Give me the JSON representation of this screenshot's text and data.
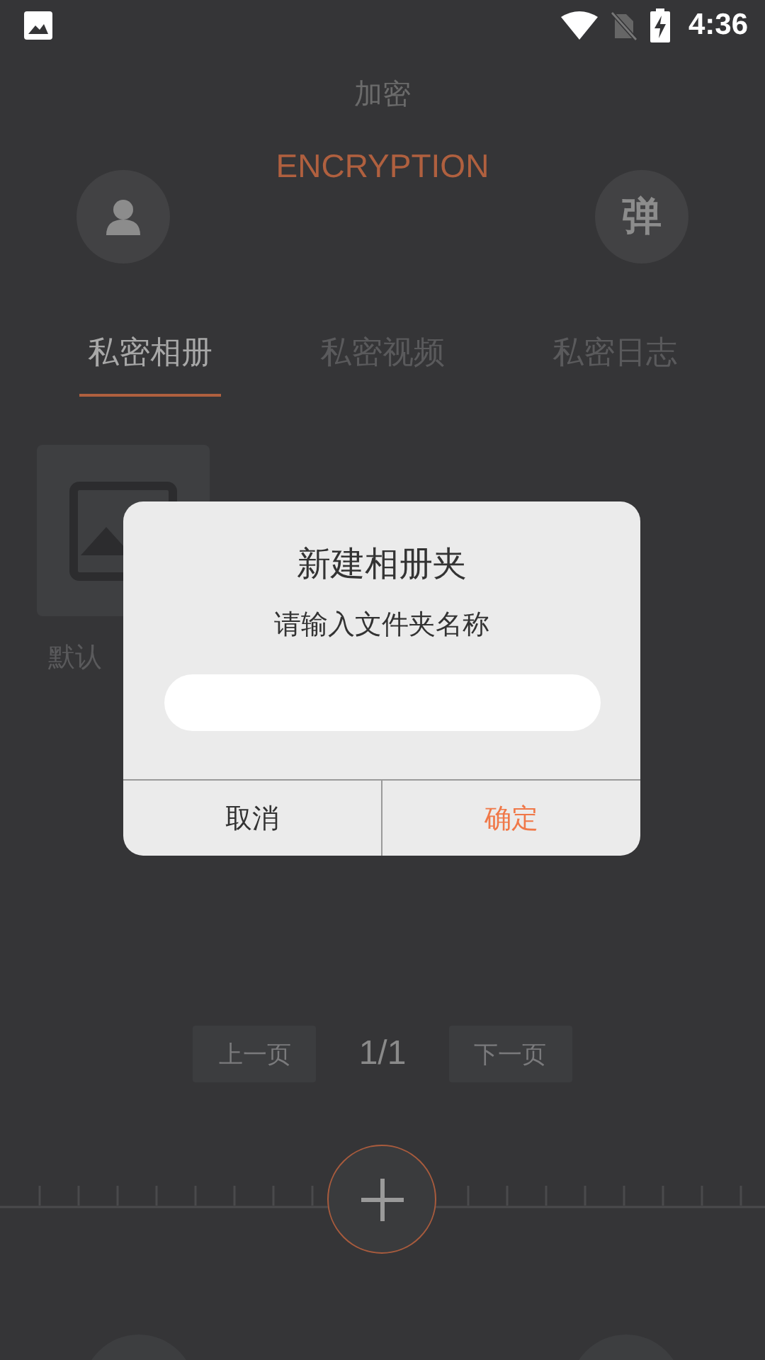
{
  "status_bar": {
    "time": "4:36"
  },
  "header": {
    "title": "加密",
    "subtitle": "ENCRYPTION",
    "right_button": "弹"
  },
  "tabs": [
    {
      "label": "私密相册",
      "selected": true
    },
    {
      "label": "私密视频",
      "selected": false
    },
    {
      "label": "私密日志",
      "selected": false
    }
  ],
  "albums": [
    {
      "name": "默认"
    }
  ],
  "pagination": {
    "prev": "上一页",
    "page": "1/1",
    "next": "下一页"
  },
  "dialog": {
    "title": "新建相册夹",
    "message": "请输入文件夹名称",
    "buttons": [
      {
        "label": "取消",
        "kind": "cancel"
      },
      {
        "label": "确定",
        "kind": "confirm"
      }
    ]
  }
}
